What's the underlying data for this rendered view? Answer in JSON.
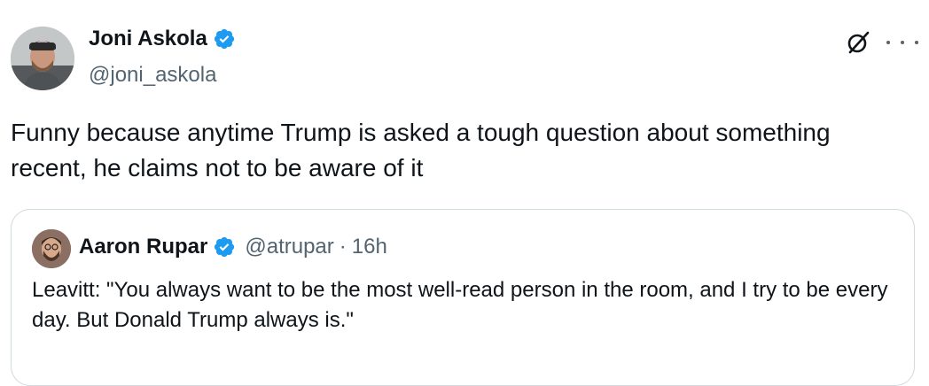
{
  "tweet": {
    "author": {
      "display_name": "Joni Askola",
      "handle": "@joni_askola",
      "verified": true
    },
    "text": "Funny because anytime Trump is asked a tough question about something recent, he claims not to be aware of it",
    "actions": [
      "grok-icon",
      "more-icon"
    ]
  },
  "quoted_tweet": {
    "author": {
      "display_name": "Aaron Rupar",
      "handle": "@atrupar",
      "verified": true
    },
    "separator": "·",
    "time": "16h",
    "text": "Leavitt: \"You always want to be the most well-read person in the room, and I try to be every day. But Donald Trump always is.\""
  },
  "colors": {
    "text": "#0f1419",
    "secondary": "#536471",
    "verified": "#1d9bf0",
    "border": "#cfd9de"
  }
}
